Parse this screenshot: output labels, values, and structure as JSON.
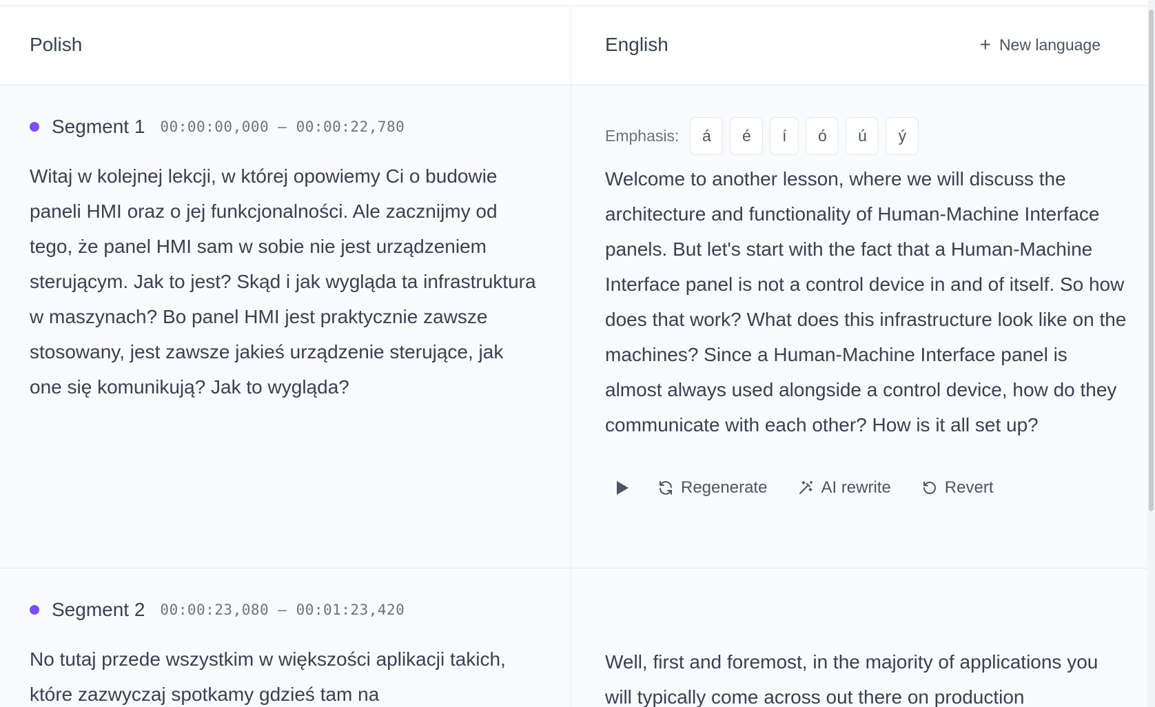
{
  "header": {
    "source_language": "Polish",
    "target_language": "English",
    "new_language_label": "New language"
  },
  "emphasis": {
    "label": "Emphasis:",
    "chars": [
      "á",
      "é",
      "í",
      "ó",
      "ú",
      "ý"
    ]
  },
  "actions": {
    "regenerate": "Regenerate",
    "ai_rewrite": "AI rewrite",
    "revert": "Revert"
  },
  "segments": [
    {
      "name": "Segment 1",
      "time": "00:00:00,000 – 00:00:22,780",
      "source_text": "Witaj w kolejnej lekcji, w której opowiemy Ci o budowie paneli HMI oraz o jej funkcjonalności. Ale zacznijmy od tego, że panel HMI sam w sobie nie jest urządzeniem sterującym. Jak to jest? Skąd i jak wygląda ta infrastruktura w maszynach? Bo panel HMI jest praktycznie zawsze stosowany, jest zawsze jakieś urządzenie sterujące, jak one się komunikują? Jak to wygląda?",
      "target_text": "Welcome to another lesson, where we will discuss the architecture and functionality of Human-Machine Interface panels. But let's start with the fact that a Human-Machine Interface panel is not a control device in and of itself. So how does that work? What does this infrastructure look like on the machines? Since a Human-Machine Interface panel is almost always used alongside a control device, how do they communicate with each other? How is it all set up?"
    },
    {
      "name": "Segment 2",
      "time": "00:00:23,080 – 00:01:23,420",
      "source_text": "No tutaj przede wszystkim w większości aplikacji takich, które zazwyczaj spotkamy gdzieś tam na",
      "target_text": "Well, first and foremost, in the majority of applications you will typically come across out there on production"
    }
  ],
  "colors": {
    "accent_dot": "#7c4dff"
  }
}
